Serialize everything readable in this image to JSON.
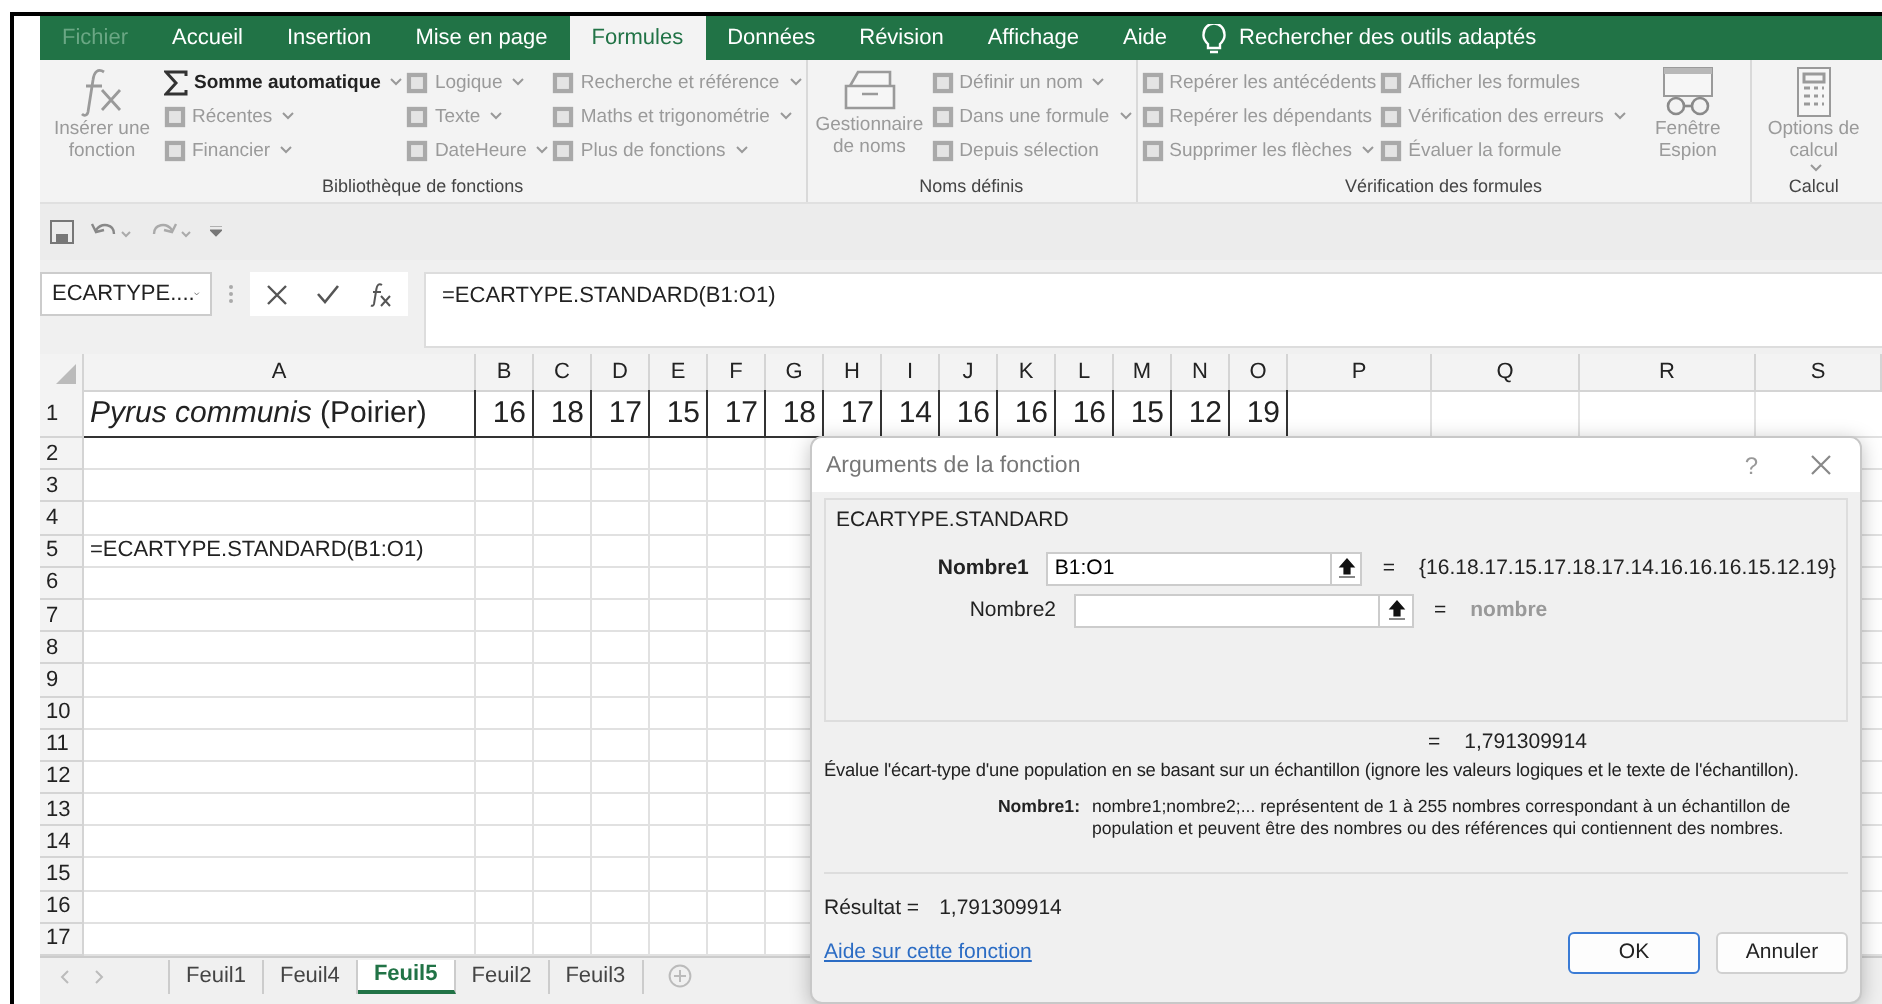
{
  "ribbon_tabs": [
    {
      "label": "Fichier",
      "selected": false,
      "disabled": true
    },
    {
      "label": "Accueil",
      "selected": false,
      "disabled": false
    },
    {
      "label": "Insertion",
      "selected": false,
      "disabled": false
    },
    {
      "label": "Mise en page",
      "selected": false,
      "disabled": false
    },
    {
      "label": "Formules",
      "selected": true,
      "disabled": false
    },
    {
      "label": "Données",
      "selected": false,
      "disabled": false
    },
    {
      "label": "Révision",
      "selected": false,
      "disabled": false
    },
    {
      "label": "Affichage",
      "selected": false,
      "disabled": false
    },
    {
      "label": "Aide",
      "selected": false,
      "disabled": false
    }
  ],
  "tell_me": {
    "label": "Rechercher des outils adaptés"
  },
  "ribbon_groups": [
    {
      "label": "Bibliothèque de fonctions",
      "blocks": [
        {
          "kind": "large",
          "label": "Insérer une fonction",
          "dropdown": false,
          "disabled": true
        },
        {
          "kind": "column",
          "items": [
            {
              "label": "Somme automatique",
              "dropdown": true,
              "disabled": false
            },
            {
              "label": "Récentes",
              "dropdown": true,
              "disabled": true
            },
            {
              "label": "Financier",
              "dropdown": true,
              "disabled": true
            }
          ]
        },
        {
          "kind": "column",
          "items": [
            {
              "label": "Logique",
              "dropdown": true,
              "disabled": true
            },
            {
              "label": "Texte",
              "dropdown": true,
              "disabled": true
            },
            {
              "label": "DateHeure",
              "dropdown": true,
              "disabled": true
            }
          ]
        },
        {
          "kind": "column",
          "items": [
            {
              "label": "Recherche et référence",
              "dropdown": true,
              "disabled": true
            },
            {
              "label": "Maths et trigonométrie",
              "dropdown": true,
              "disabled": true
            },
            {
              "label": "Plus de fonctions",
              "dropdown": true,
              "disabled": true
            }
          ]
        }
      ]
    },
    {
      "label": "Noms définis",
      "blocks": [
        {
          "kind": "large",
          "label": "Gestionnaire de noms",
          "dropdown": false,
          "disabled": true
        },
        {
          "kind": "column",
          "items": [
            {
              "label": "Définir un nom",
              "dropdown": true,
              "disabled": true
            },
            {
              "label": "Dans une formule",
              "dropdown": true,
              "disabled": true
            },
            {
              "label": "Depuis sélection",
              "dropdown": false,
              "disabled": true
            }
          ]
        }
      ]
    },
    {
      "label": "Vérification des formules",
      "blocks": [
        {
          "kind": "column",
          "items": [
            {
              "label": "Repérer les antécédents",
              "dropdown": false,
              "disabled": true
            },
            {
              "label": "Repérer les dépendants",
              "dropdown": false,
              "disabled": true
            },
            {
              "label": "Supprimer les flèches",
              "dropdown": true,
              "disabled": true
            }
          ]
        },
        {
          "kind": "column",
          "items": [
            {
              "label": "Afficher les formules",
              "dropdown": false,
              "disabled": true
            },
            {
              "label": "Vérification des erreurs",
              "dropdown": true,
              "disabled": true
            },
            {
              "label": "Évaluer la formule",
              "dropdown": false,
              "disabled": true
            }
          ]
        },
        {
          "kind": "large",
          "label": "Fenêtre Espion",
          "dropdown": false,
          "disabled": true
        }
      ]
    },
    {
      "label": "Calcul",
      "blocks": [
        {
          "kind": "large",
          "label": "Options de calcul",
          "dropdown": true,
          "disabled": true
        }
      ]
    }
  ],
  "formula_bar": {
    "name_box": "ECARTYPE....",
    "formula": "=ECARTYPE.STANDARD(B1:O1)"
  },
  "grid": {
    "columns": [
      "A",
      "B",
      "C",
      "D",
      "E",
      "F",
      "G",
      "H",
      "I",
      "J",
      "K",
      "L",
      "M",
      "N",
      "O",
      "P",
      "Q",
      "R",
      "S"
    ],
    "rows": [
      {
        "number": "1",
        "bordered": true,
        "cells": [
          "*Pyrus communis* (Poirier)",
          "16",
          "18",
          "17",
          "15",
          "17",
          "18",
          "17",
          "14",
          "16",
          "16",
          "16",
          "15",
          "12",
          "19"
        ]
      },
      {
        "number": "2",
        "bordered": false
      },
      {
        "number": "3",
        "bordered": false
      },
      {
        "number": "4",
        "bordered": false
      },
      {
        "number": "5",
        "bordered": false,
        "cells": [
          "=ECARTYPE.STANDARD(B1:O1)"
        ]
      },
      {
        "number": "6",
        "bordered": false
      },
      {
        "number": "7",
        "bordered": false
      },
      {
        "number": "8",
        "bordered": false
      },
      {
        "number": "9",
        "bordered": false
      },
      {
        "number": "10",
        "bordered": false
      },
      {
        "number": "11",
        "bordered": false
      },
      {
        "number": "12",
        "bordered": false
      },
      {
        "number": "13",
        "bordered": false
      },
      {
        "number": "14",
        "bordered": false
      },
      {
        "number": "15",
        "bordered": false
      },
      {
        "number": "16",
        "bordered": false
      },
      {
        "number": "17",
        "bordered": false
      }
    ]
  },
  "sheet_tabs": [
    {
      "label": "Feuil1",
      "selected": false
    },
    {
      "label": "Feuil4",
      "selected": false
    },
    {
      "label": "Feuil5",
      "selected": true
    },
    {
      "label": "Feuil2",
      "selected": false
    },
    {
      "label": "Feuil3",
      "selected": false
    }
  ],
  "dialog": {
    "title": "Arguments de la fonction",
    "help": "?",
    "function_name": "ECARTYPE.STANDARD",
    "args": [
      {
        "label": "Nombre1",
        "required": true,
        "value": "B1:O1",
        "equals": "=",
        "result": "{16.18.17.15.17.18.17.14.16.16.16.15.12.19}",
        "hint": false
      },
      {
        "label": "Nombre2",
        "required": false,
        "equals": "=",
        "result": "nombre",
        "hint": true
      }
    ],
    "formula_result": {
      "equals": "=",
      "value": "1,791309914"
    },
    "description": "Évalue l'écart-type d'une population en se basant sur un échantillon (ignore les valeurs logiques et le texte de l'échantillon).",
    "arg_help": {
      "label": "Nombre1:",
      "text": "nombre1;nombre2;... représentent de 1 à 255 nombres correspondant à un échantillon de population et peuvent être des nombres ou des références qui contiennent des nombres."
    },
    "result_label": "Résultat =",
    "result_value": "1,791309914",
    "help_link": "Aide sur cette fonction",
    "buttons": [
      {
        "label": "OK",
        "default": true
      },
      {
        "label": "Annuler",
        "default": false
      }
    ]
  }
}
